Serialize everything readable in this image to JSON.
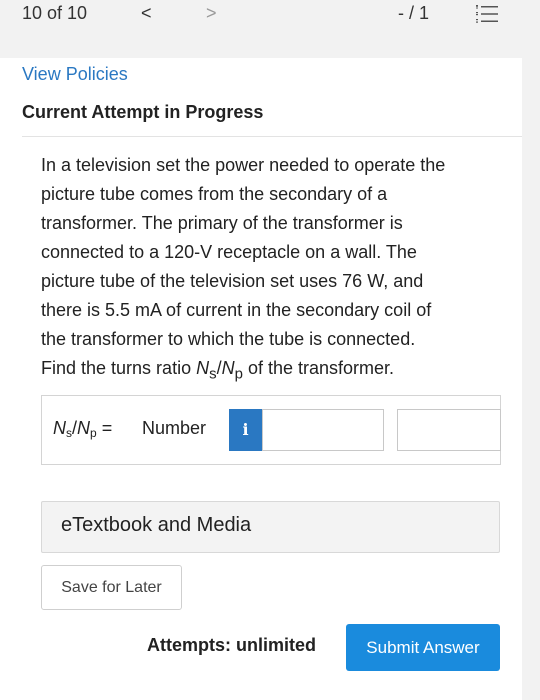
{
  "topbar": {
    "counter": "10 of 10",
    "prev_glyph": "<",
    "next_glyph": ">",
    "page_indicator": "- / 1"
  },
  "header": {
    "view_policies": "View Policies",
    "attempt_title": "Current Attempt in Progress"
  },
  "question": {
    "text_lines": [
      "In a television set the power needed to operate the",
      "picture tube comes from the secondary of a",
      "transformer. The primary of the transformer is",
      "connected to a 120-V receptacle on a wall. The",
      "picture tube of the television set uses 76 W, and",
      "there is 5.5 mA of current in the secondary coil of",
      "the transformer to which the tube is connected."
    ],
    "final_line_prefix": "Find the turns ratio ",
    "final_line_suffix": " of the transformer."
  },
  "ratio": {
    "n": "N",
    "s": "s",
    "slash": "/",
    "p": "p",
    "eq": " = "
  },
  "answer": {
    "number_label": "Number",
    "info_glyph": "i",
    "number_value": "",
    "units_value": ""
  },
  "etextbook_label": "eTextbook and Media",
  "save_later_label": "Save for Later",
  "attempts_label": "Attempts: unlimited",
  "submit_label": "Submit Answer",
  "colors": {
    "link": "#2a78c2",
    "submit": "#1a8bdd"
  }
}
